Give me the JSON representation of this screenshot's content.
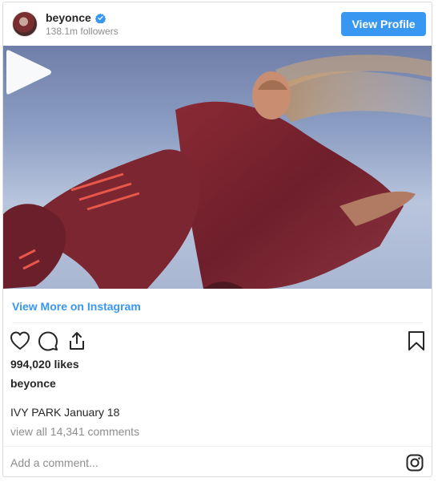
{
  "header": {
    "username": "beyonce",
    "followers": "138.1m followers",
    "view_profile_label": "View Profile"
  },
  "media": {
    "type": "video",
    "play_icon": "play-icon"
  },
  "links": {
    "view_more_label": "View More on Instagram"
  },
  "actions": {
    "icons": [
      "heart-icon",
      "comment-icon",
      "share-icon",
      "bookmark-icon"
    ]
  },
  "post": {
    "likes": "994,020 likes",
    "caption_user": "beyonce",
    "caption": "IVY PARK January 18",
    "comments_link": "view all 14,341 comments"
  },
  "footer": {
    "add_comment_placeholder": "Add a comment...",
    "brand_icon": "instagram-icon"
  },
  "colors": {
    "accent": "#3897f0",
    "text": "#262626",
    "muted": "#8e8e8e",
    "border": "#dbdbdb"
  }
}
